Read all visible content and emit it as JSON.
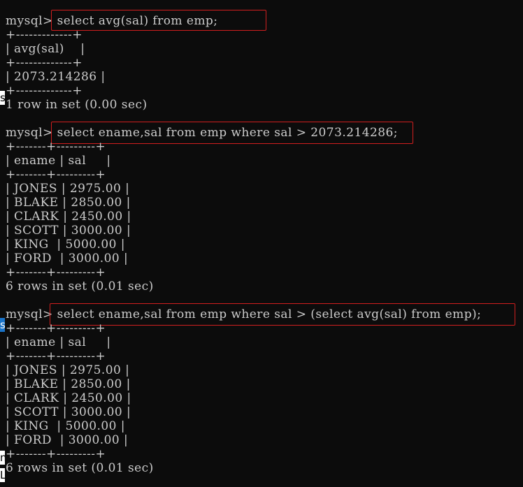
{
  "terminal": {
    "background": "#0c0c0c",
    "text_color": "#cccccc",
    "highlight_color": "#d11f1f",
    "lines": [
      "mysql> select avg(sal) from emp;",
      "+-------------+",
      "| avg(sal)    |",
      "+-------------+",
      "| 2073.214286 |",
      "+-------------+",
      "1 row in set (0.00 sec)",
      "mysql> select ename,sal from emp where sal > 2073.214286;",
      "+-------+---------+",
      "| ename | sal     |",
      "+-------+---------+",
      "| JONES | 2975.00 |",
      "| BLAKE | 2850.00 |",
      "| CLARK | 2450.00 |",
      "| SCOTT | 3000.00 |",
      "| KING  | 5000.00 |",
      "| FORD  | 3000.00 |",
      "+-------+---------+",
      "6 rows in set (0.01 sec)",
      "mysql> select ename,sal from emp where sal > (select avg(sal) from emp);",
      "+-------+---------+",
      "| ename | sal     |",
      "+-------+---------+",
      "| JONES | 2975.00 |",
      "| BLAKE | 2850.00 |",
      "| CLARK | 2450.00 |",
      "| SCOTT | 3000.00 |",
      "| KING  | 5000.00 |",
      "| FORD  | 3000.00 |",
      "+-------+---------+",
      "6 rows in set (0.01 sec)"
    ]
  },
  "edge_tabs": [
    "s",
    "s",
    "n",
    "L"
  ]
}
